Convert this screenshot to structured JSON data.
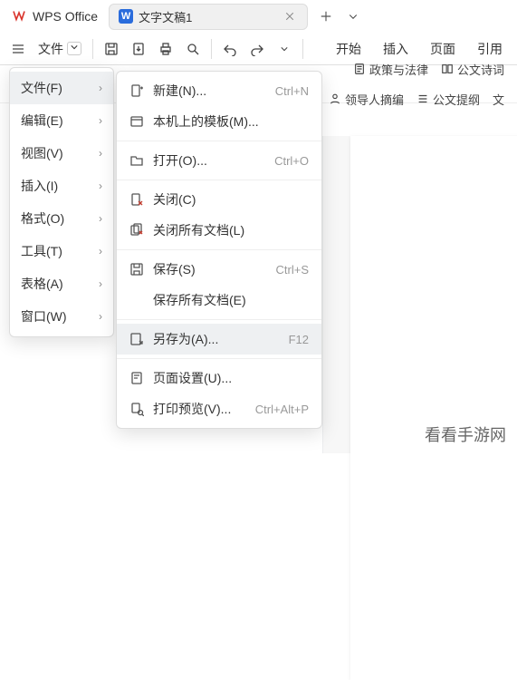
{
  "app": {
    "name": "WPS Office",
    "doc_title": "文字文稿1"
  },
  "toolbar": {
    "file_label": "文件"
  },
  "ribbon": [
    "开始",
    "插入",
    "页面",
    "引用"
  ],
  "chips_row1": [
    {
      "icon": "doc-icon",
      "label": "政策与法律"
    },
    {
      "icon": "book-icon",
      "label": "公文诗词"
    }
  ],
  "chips_row2": [
    {
      "icon": "person-icon",
      "label": "领导人摘编"
    },
    {
      "icon": "list-icon",
      "label": "公文提纲"
    },
    {
      "icon": "text-icon",
      "label": "文"
    }
  ],
  "menu1": [
    {
      "label": "文件(F)",
      "active": true
    },
    {
      "label": "编辑(E)"
    },
    {
      "label": "视图(V)"
    },
    {
      "label": "插入(I)"
    },
    {
      "label": "格式(O)"
    },
    {
      "label": "工具(T)"
    },
    {
      "label": "表格(A)"
    },
    {
      "label": "窗口(W)"
    }
  ],
  "menu2": [
    {
      "icon": "new-icon",
      "label": "新建(N)...",
      "shortcut": "Ctrl+N"
    },
    {
      "icon": "template-icon",
      "label": "本机上的模板(M)...",
      "shortcut": ""
    },
    {
      "sep": true
    },
    {
      "icon": "open-icon",
      "label": "打开(O)...",
      "shortcut": "Ctrl+O"
    },
    {
      "sep": true
    },
    {
      "icon": "close-icon",
      "label": "关闭(C)",
      "shortcut": ""
    },
    {
      "icon": "close-all-icon",
      "label": "关闭所有文档(L)",
      "shortcut": ""
    },
    {
      "sep": true
    },
    {
      "icon": "save-icon",
      "label": "保存(S)",
      "shortcut": "Ctrl+S"
    },
    {
      "icon": "blank",
      "label": "保存所有文档(E)",
      "shortcut": ""
    },
    {
      "sep": true
    },
    {
      "icon": "saveas-icon",
      "label": "另存为(A)...",
      "shortcut": "F12",
      "hover": true
    },
    {
      "sep": true
    },
    {
      "icon": "page-setup-icon",
      "label": "页面设置(U)...",
      "shortcut": ""
    },
    {
      "icon": "print-preview-icon",
      "label": "打印预览(V)...",
      "shortcut": "Ctrl+Alt+P"
    }
  ],
  "watermark": "看看手游网"
}
